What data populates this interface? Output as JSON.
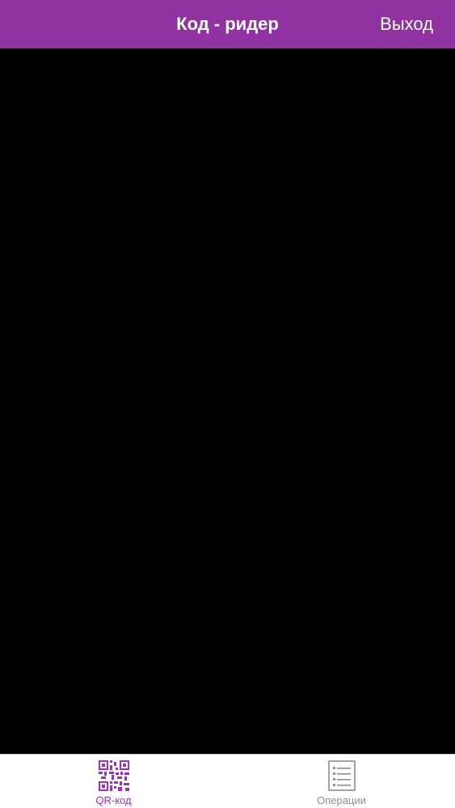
{
  "header": {
    "title": "Код - ридер",
    "exit_label": "Выход"
  },
  "tabs": [
    {
      "label": "QR-код",
      "icon": "qr-code-icon",
      "active": true
    },
    {
      "label": "Операции",
      "icon": "list-icon",
      "active": false
    }
  ],
  "colors": {
    "header_bg": "#9033a0",
    "camera_bg": "#000000",
    "active_tab": "#9a2fc0",
    "inactive_tab": "#8e8e93"
  }
}
